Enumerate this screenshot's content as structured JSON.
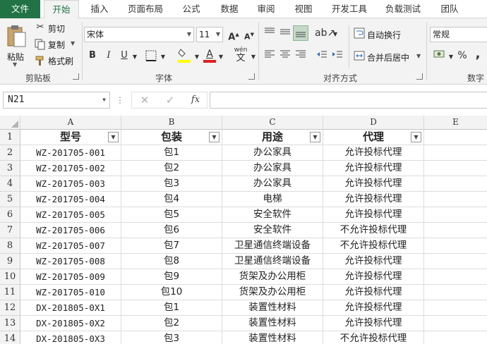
{
  "tabs": [
    {
      "label": "文件"
    },
    {
      "label": "开始"
    },
    {
      "label": "插入"
    },
    {
      "label": "页面布局"
    },
    {
      "label": "公式"
    },
    {
      "label": "数据"
    },
    {
      "label": "审阅"
    },
    {
      "label": "视图"
    },
    {
      "label": "开发工具"
    },
    {
      "label": "负载测试"
    },
    {
      "label": "团队"
    }
  ],
  "ribbon": {
    "clipboard": {
      "paste": "粘贴",
      "cut": "剪切",
      "copy": "复制",
      "format_painter": "格式刷",
      "group": "剪贴板"
    },
    "font": {
      "name": "宋体",
      "size": "11",
      "bold": "B",
      "italic": "I",
      "underline": "U",
      "font_color_letter": "A",
      "phonetic": "wén",
      "group": "字体"
    },
    "alignment": {
      "wrap": "自动换行",
      "merge": "合并后居中",
      "group": "对齐方式"
    },
    "number": {
      "format": "常规",
      "percent": "%",
      "comma": ",",
      "group": "数字"
    }
  },
  "formula_bar": {
    "name_box": "N21",
    "fx": "fx",
    "formula": ""
  },
  "columns": [
    "A",
    "B",
    "C",
    "D",
    "E"
  ],
  "header_row": [
    "型号",
    "包装",
    "用途",
    "代理"
  ],
  "rows": [
    {
      "num": "1"
    },
    {
      "num": "2",
      "a": "WZ-201705-001",
      "b": "包1",
      "c": "办公家具",
      "d": "允许投标代理"
    },
    {
      "num": "3",
      "a": "WZ-201705-002",
      "b": "包2",
      "c": "办公家具",
      "d": "允许投标代理"
    },
    {
      "num": "4",
      "a": "WZ-201705-003",
      "b": "包3",
      "c": "办公家具",
      "d": "允许投标代理"
    },
    {
      "num": "5",
      "a": "WZ-201705-004",
      "b": "包4",
      "c": "电梯",
      "d": "允许投标代理"
    },
    {
      "num": "6",
      "a": "WZ-201705-005",
      "b": "包5",
      "c": "安全软件",
      "d": "允许投标代理"
    },
    {
      "num": "7",
      "a": "WZ-201705-006",
      "b": "包6",
      "c": "安全软件",
      "d": "不允许投标代理"
    },
    {
      "num": "8",
      "a": "WZ-201705-007",
      "b": "包7",
      "c": "卫星通信终端设备",
      "d": "不允许投标代理"
    },
    {
      "num": "9",
      "a": "WZ-201705-008",
      "b": "包8",
      "c": "卫星通信终端设备",
      "d": "允许投标代理"
    },
    {
      "num": "10",
      "a": "WZ-201705-009",
      "b": "包9",
      "c": "货架及办公用柜",
      "d": "允许投标代理"
    },
    {
      "num": "11",
      "a": "WZ-201705-010",
      "b": "包10",
      "c": "货架及办公用柜",
      "d": "允许投标代理"
    },
    {
      "num": "12",
      "a": "DX-201805-0X1",
      "b": "包1",
      "c": "装置性材料",
      "d": "允许投标代理"
    },
    {
      "num": "13",
      "a": "DX-201805-0X2",
      "b": "包2",
      "c": "装置性材料",
      "d": "允许投标代理"
    },
    {
      "num": "14",
      "a": "DX-201805-0X3",
      "b": "包3",
      "c": "装置性材料",
      "d": "不允许投标代理"
    }
  ],
  "colors": {
    "accent": "#217346",
    "font_color_bar": "#e01f1f",
    "highlight_bar": "#ffff00"
  }
}
